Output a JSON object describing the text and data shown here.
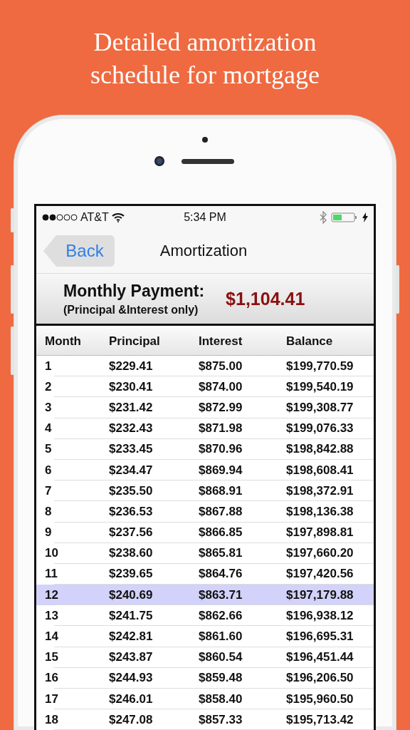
{
  "headline": "Detailed amortization schedule for mortgage",
  "status_bar": {
    "carrier": "AT&T",
    "time": "5:34 PM"
  },
  "nav": {
    "back": "Back",
    "title": "Amortization"
  },
  "payment": {
    "label": "Monthly Payment:",
    "note": "(Principal &Interest only)",
    "amount": "$1,104.41"
  },
  "table": {
    "columns": [
      "Month",
      "Principal",
      "Interest",
      "Balance"
    ],
    "rows": [
      {
        "cells": [
          "1",
          "$229.41",
          "$875.00",
          "$199,770.59"
        ],
        "selected": false
      },
      {
        "cells": [
          "2",
          "$230.41",
          "$874.00",
          "$199,540.19"
        ],
        "selected": false
      },
      {
        "cells": [
          "3",
          "$231.42",
          "$872.99",
          "$199,308.77"
        ],
        "selected": false
      },
      {
        "cells": [
          "4",
          "$232.43",
          "$871.98",
          "$199,076.33"
        ],
        "selected": false
      },
      {
        "cells": [
          "5",
          "$233.45",
          "$870.96",
          "$198,842.88"
        ],
        "selected": false
      },
      {
        "cells": [
          "6",
          "$234.47",
          "$869.94",
          "$198,608.41"
        ],
        "selected": false
      },
      {
        "cells": [
          "7",
          "$235.50",
          "$868.91",
          "$198,372.91"
        ],
        "selected": false
      },
      {
        "cells": [
          "8",
          "$236.53",
          "$867.88",
          "$198,136.38"
        ],
        "selected": false
      },
      {
        "cells": [
          "9",
          "$237.56",
          "$866.85",
          "$197,898.81"
        ],
        "selected": false
      },
      {
        "cells": [
          "10",
          "$238.60",
          "$865.81",
          "$197,660.20"
        ],
        "selected": false
      },
      {
        "cells": [
          "11",
          "$239.65",
          "$864.76",
          "$197,420.56"
        ],
        "selected": false
      },
      {
        "cells": [
          "12",
          "$240.69",
          "$863.71",
          "$197,179.88"
        ],
        "selected": true
      },
      {
        "cells": [
          "13",
          "$241.75",
          "$862.66",
          "$196,938.12"
        ],
        "selected": false
      },
      {
        "cells": [
          "14",
          "$242.81",
          "$861.60",
          "$196,695.31"
        ],
        "selected": false
      },
      {
        "cells": [
          "15",
          "$243.87",
          "$860.54",
          "$196,451.44"
        ],
        "selected": false
      },
      {
        "cells": [
          "16",
          "$244.93",
          "$859.48",
          "$196,206.50"
        ],
        "selected": false
      },
      {
        "cells": [
          "17",
          "$246.01",
          "$858.40",
          "$195,960.50"
        ],
        "selected": false
      },
      {
        "cells": [
          "18",
          "$247.08",
          "$857.33",
          "$195,713.42"
        ],
        "selected": false
      }
    ]
  }
}
